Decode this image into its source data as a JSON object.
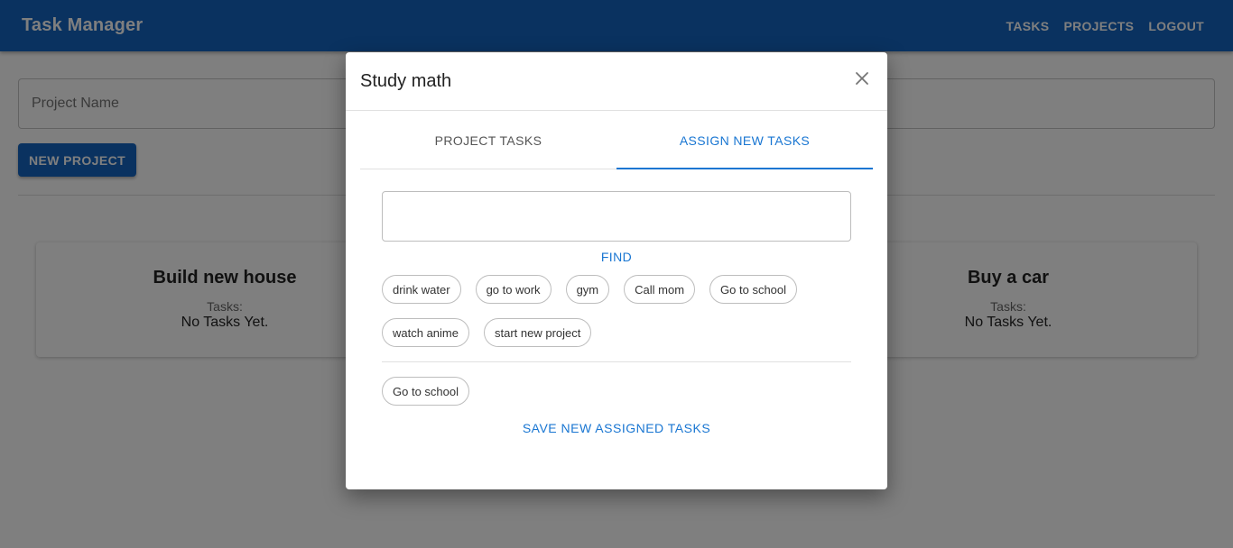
{
  "appbar": {
    "title": "Task Manager",
    "nav": [
      "TASKS",
      "PROJECTS",
      "LOGOUT"
    ]
  },
  "project_form": {
    "name_placeholder": "Project Name",
    "new_button": "NEW PROJECT"
  },
  "cards": [
    {
      "title": "Build new house",
      "tasks_label": "Tasks:",
      "tasks_value": "No Tasks Yet."
    },
    {
      "title": "Buy a car",
      "tasks_label": "Tasks:",
      "tasks_value": "No Tasks Yet."
    }
  ],
  "dialog": {
    "title": "Study math",
    "tabs": [
      {
        "label": "PROJECT TASKS",
        "active": false
      },
      {
        "label": "ASSIGN NEW TASKS",
        "active": true
      }
    ],
    "search_value": "",
    "find_label": "FIND",
    "available_tasks": [
      "drink water",
      "go to work",
      "gym",
      "Call mom",
      "Go to school",
      "watch anime",
      "start new project"
    ],
    "assigned_tasks": [
      "Go to school"
    ],
    "save_label": "SAVE NEW ASSIGNED TASKS"
  },
  "colors": {
    "primary": "#1565c0",
    "accent": "#1976d2"
  }
}
